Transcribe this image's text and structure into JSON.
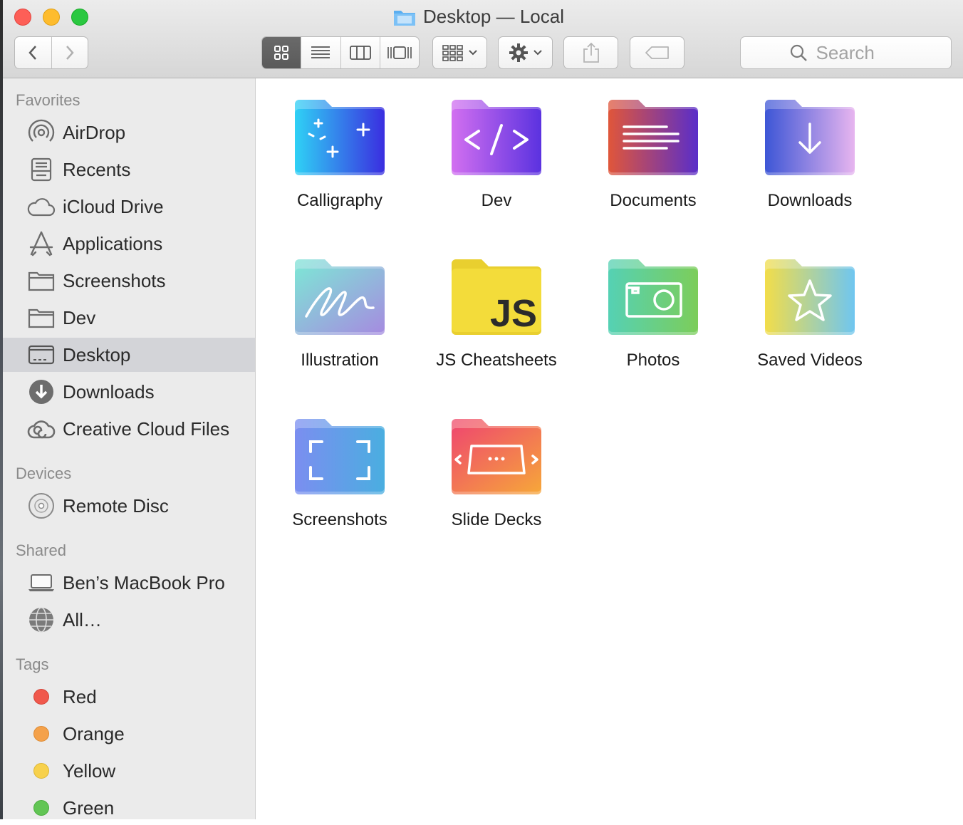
{
  "window": {
    "title": "Desktop — Local"
  },
  "toolbar": {
    "back_icon": "chevron-left-icon",
    "forward_icon": "chevron-right-icon",
    "view_modes": [
      "icon-view",
      "list-view",
      "column-view",
      "gallery-view"
    ],
    "active_view": "icon-view",
    "group_icon": "group-grid-icon",
    "action_icon": "gear-icon",
    "share_icon": "share-icon",
    "tag_icon": "tag-icon",
    "search_placeholder": "Search"
  },
  "sidebar": {
    "favorites_header": "Favorites",
    "favorites": [
      {
        "label": "AirDrop",
        "icon": "airdrop-icon"
      },
      {
        "label": "Recents",
        "icon": "recents-icon"
      },
      {
        "label": "iCloud Drive",
        "icon": "cloud-icon"
      },
      {
        "label": "Applications",
        "icon": "applications-icon"
      },
      {
        "label": "Screenshots",
        "icon": "folder-icon"
      },
      {
        "label": "Dev",
        "icon": "folder-icon"
      },
      {
        "label": "Desktop",
        "icon": "desktop-icon",
        "selected": true
      },
      {
        "label": "Downloads",
        "icon": "download-icon"
      },
      {
        "label": "Creative Cloud Files",
        "icon": "creative-cloud-icon"
      }
    ],
    "devices_header": "Devices",
    "devices": [
      {
        "label": "Remote Disc",
        "icon": "disc-icon"
      }
    ],
    "shared_header": "Shared",
    "shared": [
      {
        "label": "Ben’s MacBook Pro",
        "icon": "laptop-icon"
      },
      {
        "label": "All…",
        "icon": "network-globe-icon"
      }
    ],
    "tags_header": "Tags",
    "tags": [
      {
        "label": "Red",
        "color": "#f0584c"
      },
      {
        "label": "Orange",
        "color": "#f4a14a"
      },
      {
        "label": "Yellow",
        "color": "#f7d14c"
      },
      {
        "label": "Green",
        "color": "#62c554"
      }
    ]
  },
  "content": {
    "items": [
      {
        "name": "Calligraphy",
        "icon": "calligraphy-folder-icon"
      },
      {
        "name": "Dev",
        "icon": "code-folder-icon"
      },
      {
        "name": "Documents",
        "icon": "documents-folder-icon"
      },
      {
        "name": "Downloads",
        "icon": "downloads-folder-icon"
      },
      {
        "name": "Illustration",
        "icon": "illustration-folder-icon"
      },
      {
        "name": "JS Cheatsheets",
        "icon": "js-folder-icon"
      },
      {
        "name": "Photos",
        "icon": "photos-folder-icon"
      },
      {
        "name": "Saved Videos",
        "icon": "star-folder-icon"
      },
      {
        "name": "Screenshots",
        "icon": "screenshot-folder-icon"
      },
      {
        "name": "Slide Decks",
        "icon": "slides-folder-icon"
      }
    ]
  },
  "icon_art": {
    "js": "JS"
  }
}
